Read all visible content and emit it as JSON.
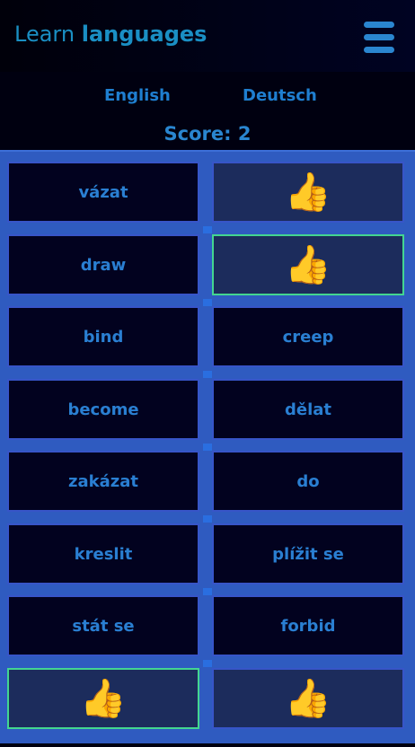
{
  "header": {
    "title_word1": "Learn",
    "title_word2": "languages",
    "menu_icon": "hamburger-menu-icon"
  },
  "languages": {
    "first": "English",
    "second": "Deutsch"
  },
  "score_text": "Score: 2",
  "board": {
    "matched_icon": "thumbs-up-icon",
    "matched_glyph": "👍",
    "rows": [
      {
        "left": {
          "text": "vázat",
          "state": "word"
        },
        "right": {
          "text": "",
          "state": "matched"
        }
      },
      {
        "left": {
          "text": "draw",
          "state": "word"
        },
        "right": {
          "text": "",
          "state": "matched-new"
        }
      },
      {
        "left": {
          "text": "bind",
          "state": "word"
        },
        "right": {
          "text": "creep",
          "state": "word"
        }
      },
      {
        "left": {
          "text": "become",
          "state": "word"
        },
        "right": {
          "text": "dělat",
          "state": "word"
        }
      },
      {
        "left": {
          "text": "zakázat",
          "state": "word"
        },
        "right": {
          "text": "do",
          "state": "word"
        }
      },
      {
        "left": {
          "text": "kreslit",
          "state": "word"
        },
        "right": {
          "text": "plížit se",
          "state": "word"
        }
      },
      {
        "left": {
          "text": "stát se",
          "state": "word"
        },
        "right": {
          "text": "forbid",
          "state": "word"
        }
      },
      {
        "left": {
          "text": "",
          "state": "matched-new"
        },
        "right": {
          "text": "",
          "state": "matched"
        }
      }
    ]
  },
  "colors": {
    "background": "#000010",
    "board": "#2f5bc0",
    "cell": "#02021f",
    "matched_cell": "#1c2c5c",
    "text_accent": "#2a7fd2",
    "new_match_border": "#43d690"
  }
}
